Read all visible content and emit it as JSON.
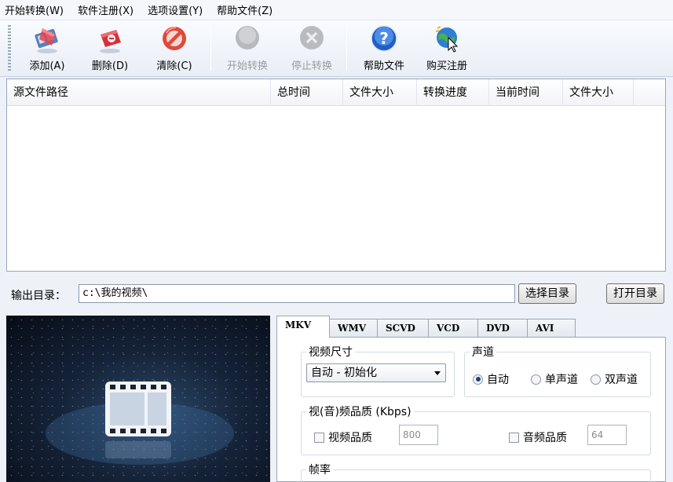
{
  "menu": [
    "开始转换(W)",
    "软件注册(X)",
    "选项设置(Y)",
    "帮助文件(Z)"
  ],
  "toolbar": {
    "add": "添加(A)",
    "delete": "删除(D)",
    "clear": "清除(C)",
    "start": "开始转换",
    "stop": "停止转换",
    "help": "帮助文件",
    "buy": "购买注册"
  },
  "file_list": {
    "columns": [
      "源文件路径",
      "总时间",
      "文件大小",
      "转换进度",
      "当前时间",
      "文件大小"
    ]
  },
  "output": {
    "label": "输出目录：",
    "path": "c:\\我的视频\\",
    "choose_button": "选择目录",
    "open_button": "打开目录"
  },
  "tabs": [
    "MKV",
    "WMV",
    "SCVD",
    "VCD",
    "DVD",
    "AVI"
  ],
  "settings": {
    "video_size_title": "视频尺寸",
    "video_size_value": "自动 - 初始化",
    "channel_title": "声道",
    "channel_options": [
      "自动",
      "单声道",
      "双声道"
    ],
    "channel_selected": "自动",
    "quality_title": "视(音)频品质 (Kbps)",
    "video_quality_label": "视频品质",
    "video_quality_value": "800",
    "audio_quality_label": "音频品质",
    "audio_quality_value": "64",
    "framerate_title": "帧率"
  },
  "colors": {
    "accent_blue": "#1f5fc4",
    "add_red": "#d8303a",
    "clear_red": "#d33a2c",
    "disabled_gray": "#9c9c9c"
  }
}
